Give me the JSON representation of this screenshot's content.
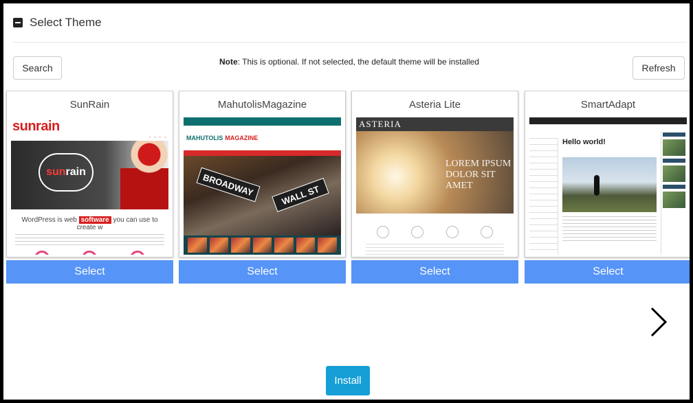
{
  "header": {
    "title": "Select Theme"
  },
  "toolbar": {
    "search_label": "Search",
    "refresh_label": "Refresh",
    "note_label": "Note",
    "note_text": ": This is optional. If not selected, the default theme will be installed"
  },
  "themes": [
    {
      "name": "SunRain",
      "select_label": "Select"
    },
    {
      "name": "MahutolisMagazine",
      "select_label": "Select"
    },
    {
      "name": "Asteria Lite",
      "select_label": "Select"
    },
    {
      "name": "SmartAdapt",
      "select_label": "Select"
    }
  ],
  "thumbs": {
    "sunrain_logo": "sunrain",
    "sunrain_tagline_pre": "WordPress is web",
    "sunrain_tagline_hl": "software",
    "sunrain_tagline_post": "you can use to create w",
    "magazine_logo": "MAHUTOLIS",
    "magazine_logo_accent": "MAGAZINE",
    "magazine_sign1": "BROADWAY",
    "magazine_sign2": "WALL ST",
    "asteria_logo": "ASTERIA",
    "asteria_hero": "LOREM IPSUM DOLOR SIT AMET",
    "smartadapt_hello": "Hello world!"
  },
  "install_label": "Install",
  "colors": {
    "select_blue": "#5694f7",
    "install_blue": "#169ed6"
  }
}
